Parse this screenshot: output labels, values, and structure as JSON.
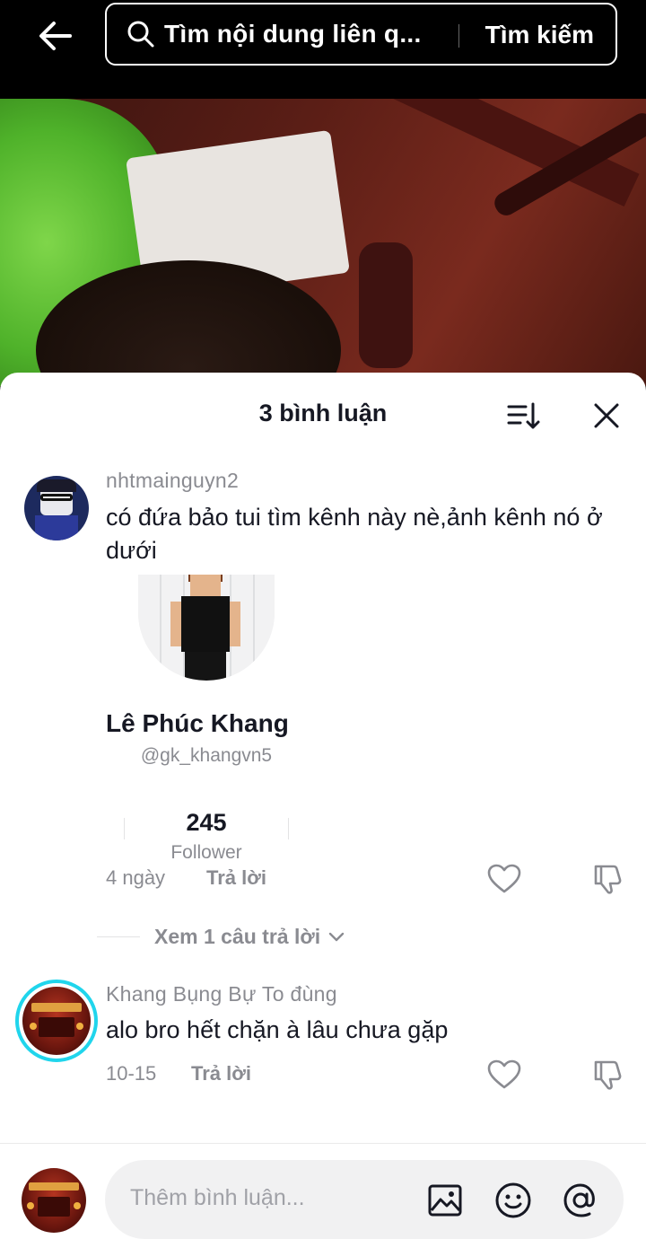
{
  "search": {
    "placeholder": "Tìm nội dung liên q...",
    "submit_label": "Tìm kiếm"
  },
  "sheet": {
    "title": "3 bình luận"
  },
  "comments": [
    {
      "username": "nhtmainguyn2",
      "text": "có đứa bảo tui tìm kênh này nè,ảnh kênh nó ở dưới",
      "time": "4 ngày",
      "reply_label": "Trả lời",
      "profile_card": {
        "name": "Lê Phúc Khang",
        "handle": "@gk_khangvn5",
        "count": "245",
        "count_label": "Follower"
      },
      "view_replies_label": "Xem 1 câu trả lời"
    },
    {
      "username": "Khang Bụng Bự To đùng",
      "text": "alo bro hết chặn à lâu chưa gặp",
      "time": "10-15",
      "reply_label": "Trả lời"
    }
  ],
  "composer": {
    "placeholder": "Thêm bình luận..."
  },
  "icons": [
    "back-arrow-icon",
    "search-icon",
    "sort-icon",
    "close-icon",
    "heart-icon",
    "dislike-icon",
    "chevron-down-icon",
    "image-icon",
    "emoji-icon",
    "at-icon"
  ],
  "colors": {
    "accent_ring": "#20d5ec",
    "text_primary": "#161823",
    "text_secondary": "#8a8b91"
  }
}
